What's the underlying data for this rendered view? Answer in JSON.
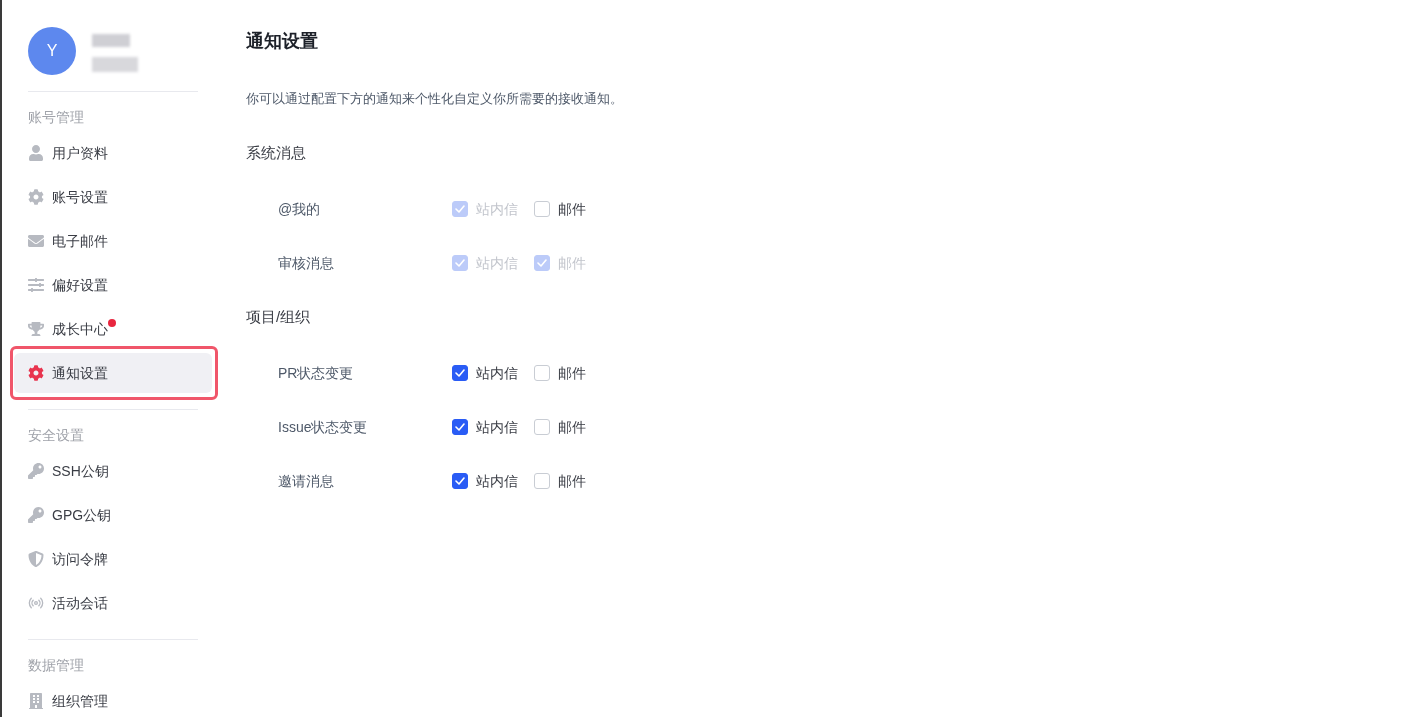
{
  "sidebar": {
    "avatar": {
      "initial": "Y"
    },
    "sections": [
      {
        "title": "账号管理",
        "items": [
          {
            "label": "用户资料",
            "selected": false,
            "highlighted": false,
            "notification_dot": false
          },
          {
            "label": "账号设置",
            "selected": false,
            "highlighted": false,
            "notification_dot": false
          },
          {
            "label": "电子邮件",
            "selected": false,
            "highlighted": false,
            "notification_dot": false
          },
          {
            "label": "偏好设置",
            "selected": false,
            "highlighted": false,
            "notification_dot": false
          },
          {
            "label": "成长中心",
            "selected": false,
            "highlighted": false,
            "notification_dot": true
          },
          {
            "label": "通知设置",
            "selected": true,
            "highlighted": true,
            "notification_dot": false
          }
        ]
      },
      {
        "title": "安全设置",
        "items": [
          {
            "label": "SSH公钥",
            "selected": false,
            "highlighted": false,
            "notification_dot": false
          },
          {
            "label": "GPG公钥",
            "selected": false,
            "highlighted": false,
            "notification_dot": false
          },
          {
            "label": "访问令牌",
            "selected": false,
            "highlighted": false,
            "notification_dot": false
          },
          {
            "label": "活动会话",
            "selected": false,
            "highlighted": false,
            "notification_dot": false
          }
        ]
      },
      {
        "title": "数据管理",
        "items": [
          {
            "label": "组织管理",
            "selected": false,
            "highlighted": false,
            "notification_dot": false
          }
        ]
      }
    ]
  },
  "main": {
    "title": "通知设置",
    "description": "你可以通过配置下方的通知来个性化自定义你所需要的接收通知。",
    "groups": [
      {
        "title": "系统消息",
        "rows": [
          {
            "label": "@我的",
            "options": [
              {
                "label": "站内信",
                "checked": true,
                "disabled": true
              },
              {
                "label": "邮件",
                "checked": false,
                "disabled": false
              }
            ]
          },
          {
            "label": "审核消息",
            "options": [
              {
                "label": "站内信",
                "checked": true,
                "disabled": true
              },
              {
                "label": "邮件",
                "checked": true,
                "disabled": true
              }
            ]
          }
        ]
      },
      {
        "title": "项目/组织",
        "rows": [
          {
            "label": "PR状态变更",
            "options": [
              {
                "label": "站内信",
                "checked": true,
                "disabled": false
              },
              {
                "label": "邮件",
                "checked": false,
                "disabled": false
              }
            ]
          },
          {
            "label": "Issue状态变更",
            "options": [
              {
                "label": "站内信",
                "checked": true,
                "disabled": false
              },
              {
                "label": "邮件",
                "checked": false,
                "disabled": false
              }
            ]
          },
          {
            "label": "邀请消息",
            "options": [
              {
                "label": "站内信",
                "checked": true,
                "disabled": false
              },
              {
                "label": "邮件",
                "checked": false,
                "disabled": false
              }
            ]
          }
        ]
      }
    ]
  }
}
